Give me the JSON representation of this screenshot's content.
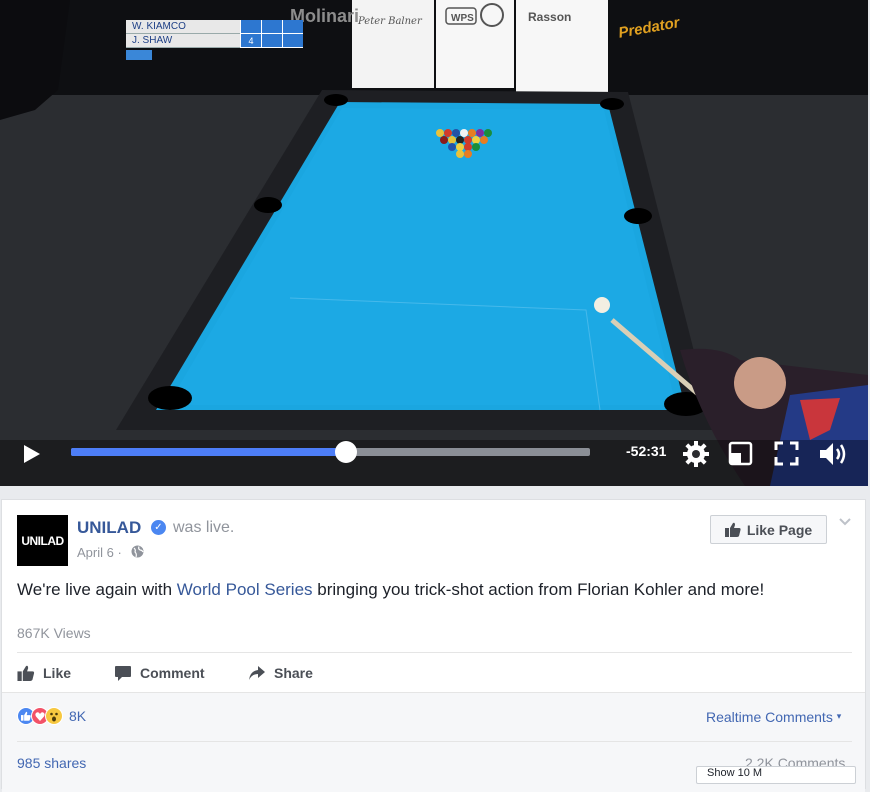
{
  "video": {
    "scoreboard": {
      "players": [
        {
          "name": "W. KIAMCO",
          "scores": [
            "",
            "",
            ""
          ]
        },
        {
          "name": "J. SHAW",
          "scores": [
            "4",
            "",
            ""
          ]
        }
      ]
    },
    "banner_brands": [
      "Molinari",
      "Peter Balner",
      "WPS",
      "Rasson",
      "Predator"
    ],
    "progress": 0.53,
    "time_remaining": "-52:31",
    "colors": {
      "cloth": "#1aa6e0",
      "progress": "#4d7ef7"
    }
  },
  "post": {
    "avatar_text": "UNILAD",
    "page_name": "UNILAD",
    "status": "was live.",
    "date": "April 6",
    "date_separator": "·",
    "like_page_label": "Like Page",
    "text_before": "We're live again with ",
    "text_link": "World Pool Series",
    "text_after": " bringing you trick-shot action from Florian Kohler and more!",
    "views": "867K Views",
    "actions": {
      "like": "Like",
      "comment": "Comment",
      "share": "Share"
    },
    "reactions": {
      "icons": [
        "like-reaction-icon",
        "love-reaction-icon",
        "wow-reaction-icon"
      ],
      "count": "8K"
    },
    "realtime_comments": "Realtime Comments",
    "shares": "985 shares",
    "comments_count": "2.2K Comments",
    "stub_text": "Show 10 M"
  }
}
